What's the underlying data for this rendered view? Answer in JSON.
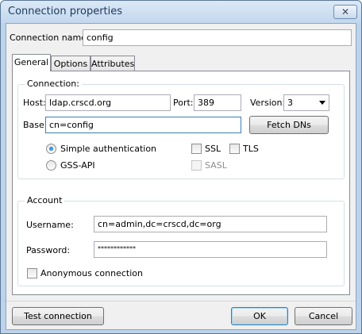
{
  "window": {
    "title": "Connection properties",
    "close_glyph": "✕"
  },
  "connection_name": {
    "label": "Connection name:",
    "value": "config"
  },
  "tabs": [
    {
      "label": "General",
      "active": true
    },
    {
      "label": "Options",
      "active": false
    },
    {
      "label": "Attributes",
      "active": false
    }
  ],
  "connection": {
    "legend": "Connection:",
    "host_label": "Host:",
    "host_value": "ldap.crscd.org",
    "port_label": "Port:",
    "port_value": "389",
    "version_label": "Version:",
    "version_value": "3",
    "base_label": "Base:",
    "base_value": "cn=config",
    "fetch_dns_label": "Fetch DNs",
    "simple_auth_label": "Simple authentication",
    "gssapi_label": "GSS-API",
    "ssl_label": "SSL",
    "tls_label": "TLS",
    "sasl_label": "SASL"
  },
  "account": {
    "legend": "Account",
    "username_label": "Username:",
    "username_value": "cn=admin,dc=crscd,dc=org",
    "password_label": "Password:",
    "password_value": "************",
    "anonymous_label": "Anonymous connection"
  },
  "footer": {
    "test_label": "Test connection",
    "ok_label": "OK",
    "cancel_label": "Cancel"
  },
  "icons": {
    "select_arrow": "chevron-down-icon",
    "close": "close-icon"
  }
}
